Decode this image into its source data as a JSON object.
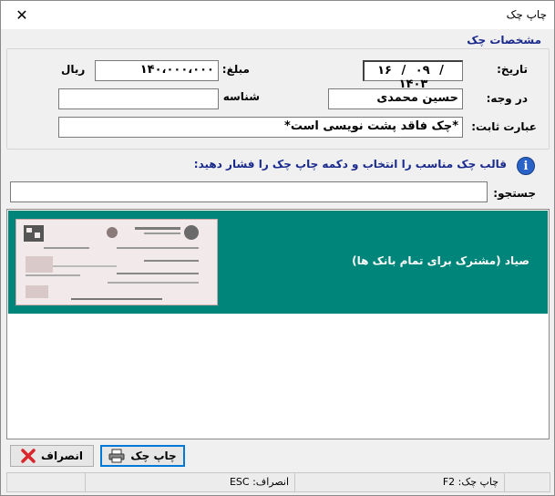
{
  "window": {
    "title": "چاپ چک",
    "close_glyph": "✕"
  },
  "section": {
    "title": "مشخصات چک"
  },
  "form": {
    "date_label": "تاریخ:",
    "date_day": "۱۶",
    "date_month": "۰۹",
    "date_year": "۱۴۰۳",
    "date_sep": "/",
    "amount_label": "مبلغ:",
    "amount_value": "۱۴۰،۰۰۰،۰۰۰",
    "currency": "ریال",
    "payee_label": "در وجه:",
    "payee_value": "حسین محمدی",
    "national_id_label": "شناسه ملی:",
    "national_id_value": "",
    "phrase_label": "عبارت ثابت:",
    "phrase_value": "*چک فاقد پشت نویسی است*"
  },
  "hint": {
    "text": "قالب چک مناسب را انتخاب و دکمه چاپ چک را فشار دهید:",
    "icon": "info-icon"
  },
  "search": {
    "label": "جستجو:",
    "value": ""
  },
  "templates": [
    {
      "label": "صیاد (مشترک برای تمام بانک ها)",
      "selected": true
    }
  ],
  "buttons": {
    "print_label": "چاپ چک",
    "cancel_label": "انصراف",
    "print_icon": "printer-icon",
    "cancel_icon": "cancel-x-icon"
  },
  "statusbar": {
    "print_shortcut": "چاپ چک: F2",
    "cancel_shortcut": "انصراف: ESC"
  },
  "colors": {
    "selected_row": "#00857a",
    "heading": "#1a2a8c",
    "cancel_icon": "#d9262c"
  }
}
